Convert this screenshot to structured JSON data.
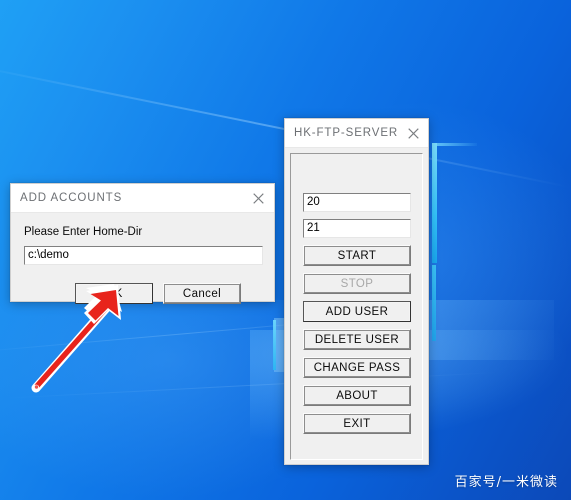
{
  "desktop": {
    "wallpaper_name": "windows-10-default-wallpaper",
    "background_colors": {
      "top_left": "#1fa0f5",
      "bottom_right": "#0c49b8",
      "logo_edge_cyan": "#35c7fb"
    },
    "watermark": "百家号/一米微读"
  },
  "ftp_server_window": {
    "title": "HK-FTP-SERVER",
    "close_icon": "close-icon",
    "fields": [
      {
        "name": "data-port",
        "value": "20"
      },
      {
        "name": "control-port",
        "value": "21"
      }
    ],
    "buttons": [
      {
        "name": "start",
        "label": "START",
        "state": "enabled"
      },
      {
        "name": "stop",
        "label": "STOP",
        "state": "disabled"
      },
      {
        "name": "add-user",
        "label": "ADD USER",
        "state": "default"
      },
      {
        "name": "delete-user",
        "label": "DELETE USER",
        "state": "enabled"
      },
      {
        "name": "change-pass",
        "label": "CHANGE PASS",
        "state": "enabled"
      },
      {
        "name": "about",
        "label": "ABOUT",
        "state": "enabled"
      },
      {
        "name": "exit",
        "label": "EXIT",
        "state": "enabled"
      }
    ]
  },
  "add_accounts_dialog": {
    "title": "ADD ACCOUNTS",
    "close_icon": "close-icon",
    "prompt_label": "Please Enter Home-Dir",
    "home_dir_value": "c:\\demo",
    "ok_label": "OK",
    "cancel_label": "Cancel"
  },
  "annotation": {
    "arrow": {
      "name": "red-arrow-pointer",
      "color": "#e8241c",
      "outline_color": "#ffffff",
      "points_to": "OK"
    }
  }
}
